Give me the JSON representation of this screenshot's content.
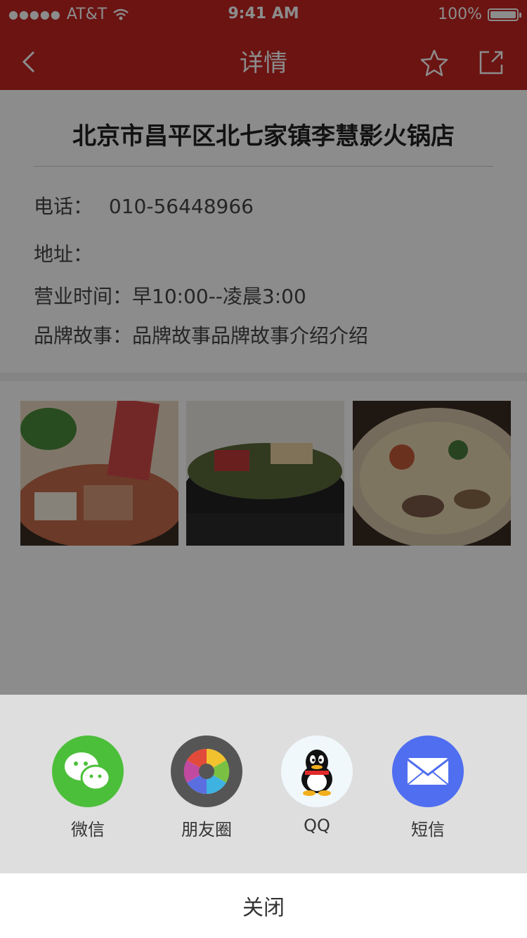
{
  "status_bar": {
    "carrier": "AT&T",
    "time": "9:41 AM",
    "battery": "100%"
  },
  "nav": {
    "title": "详情"
  },
  "shop": {
    "name": "北京市昌平区北七家镇李慧影火锅店",
    "phone_label": "电话：",
    "phone": "010-56448966",
    "address_label": "地址：",
    "hours_label": "营业时间：",
    "hours": "早10:00--凌晨3:00",
    "story_label": "品牌故事：",
    "story": "品牌故事品牌故事介绍介绍"
  },
  "share_sheet": {
    "items": [
      {
        "label": "微信",
        "icon": "wechat-icon"
      },
      {
        "label": "朋友圈",
        "icon": "moments-icon"
      },
      {
        "label": "QQ",
        "icon": "qq-icon"
      },
      {
        "label": "短信",
        "icon": "sms-icon"
      }
    ],
    "close_label": "关闭"
  },
  "colors": {
    "brand_red": "#c42622",
    "wechat_green": "#4cbf3a",
    "sms_blue": "#4f6ef0"
  }
}
